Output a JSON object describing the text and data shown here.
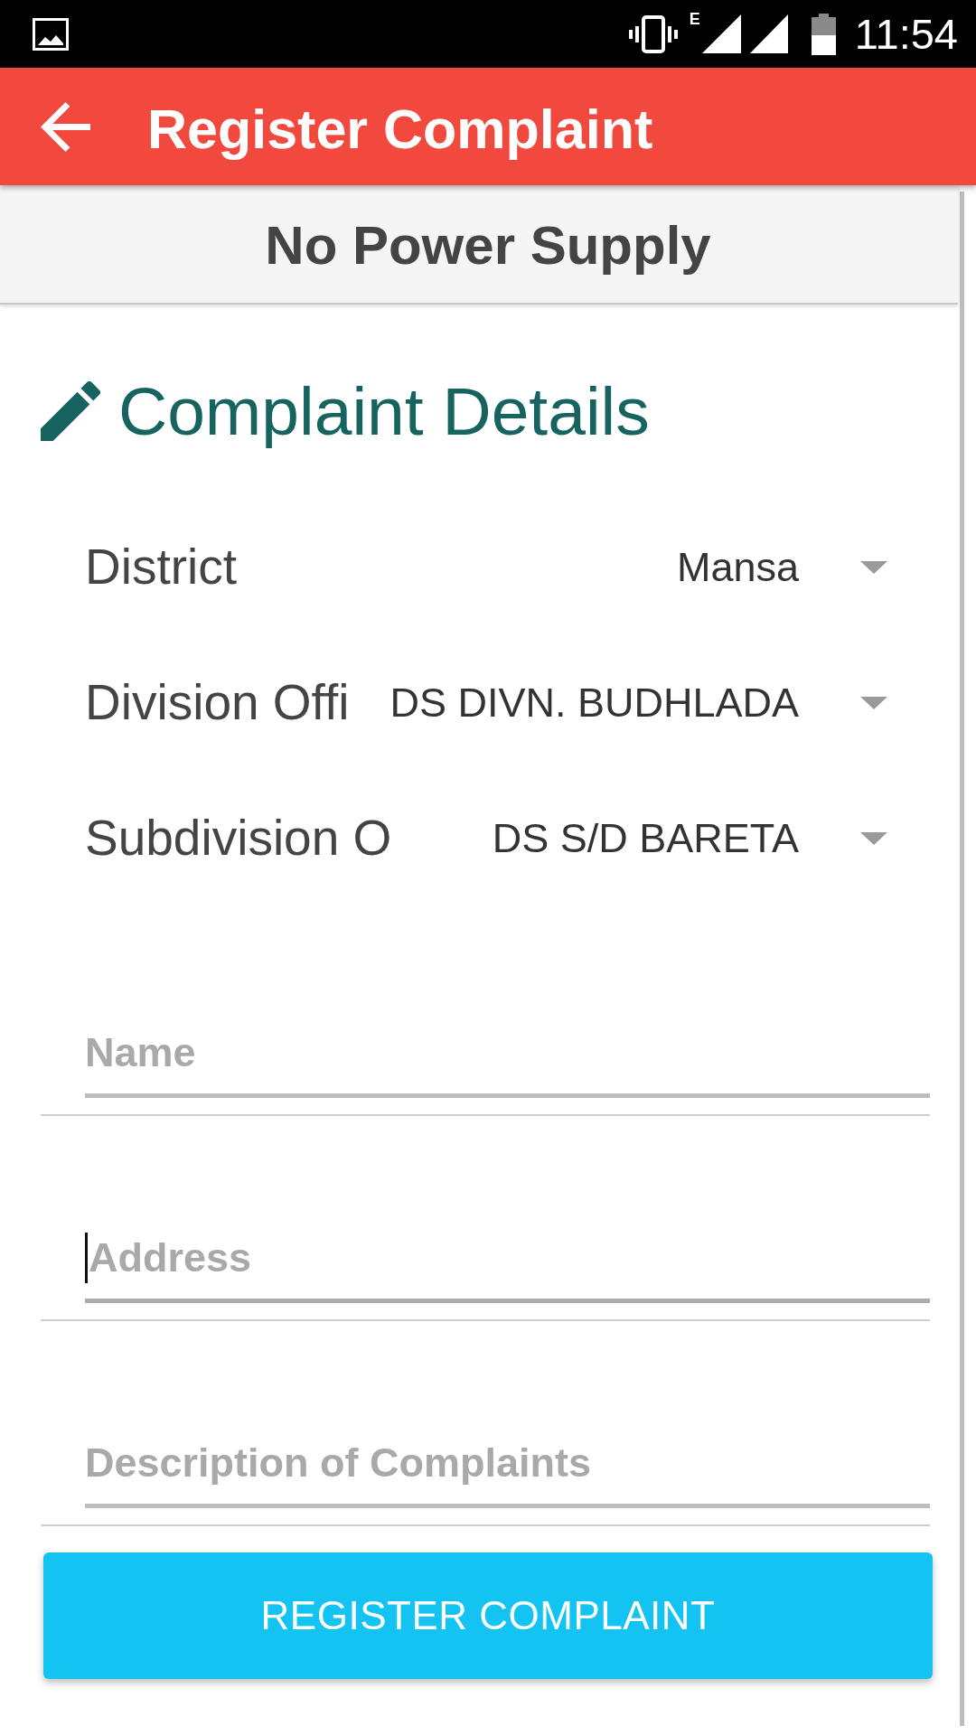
{
  "status_bar": {
    "network_type": "E",
    "time": "11:54"
  },
  "app_bar": {
    "title": "Register Complaint"
  },
  "category": {
    "title": "No Power Supply"
  },
  "section": {
    "title": "Complaint Details"
  },
  "dropdowns": [
    {
      "label": "District",
      "value": "Mansa"
    },
    {
      "label": "Division Offi",
      "value": "DS DIVN. BUDHLADA"
    },
    {
      "label": "Subdivision O",
      "value": "DS S/D BARETA"
    }
  ],
  "fields": [
    {
      "placeholder": "Name",
      "focused": false
    },
    {
      "placeholder": "Address",
      "focused": true
    },
    {
      "placeholder": "Description of Complaints",
      "focused": false
    }
  ],
  "submit_button": {
    "label": "REGISTER COMPLAINT"
  }
}
